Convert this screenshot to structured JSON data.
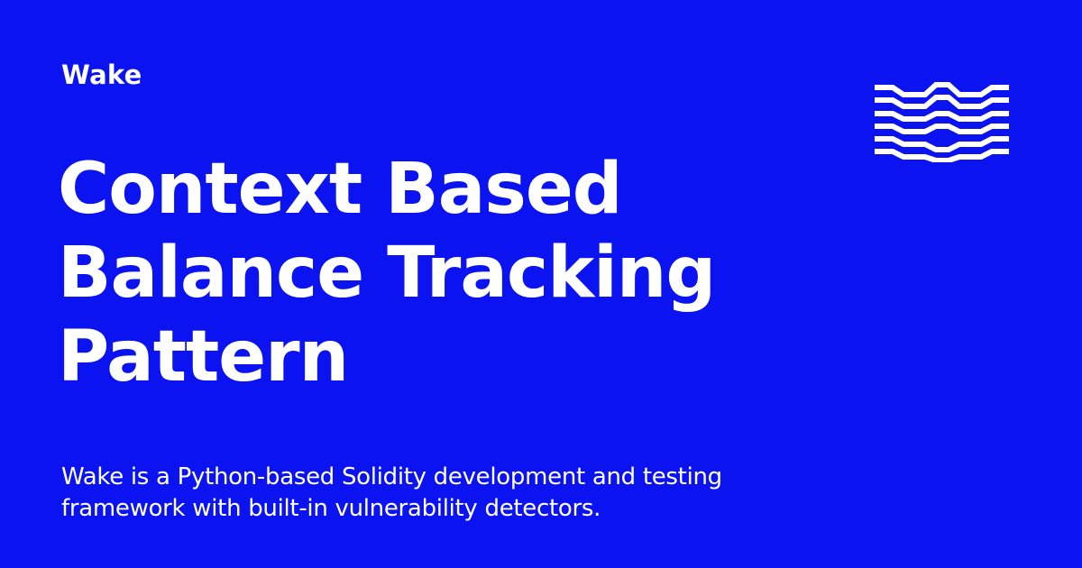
{
  "brand": "Wake",
  "title_lines": [
    "Context Based",
    "Balance Tracking",
    "Pattern"
  ],
  "description_lines": [
    "Wake is a Python-based Solidity development and testing",
    "framework with built-in vulnerability detectors."
  ],
  "colors": {
    "background": "#0a13f0",
    "text": "#ffffff"
  },
  "logo": {
    "icon": "wave-stripes-logo-icon"
  }
}
